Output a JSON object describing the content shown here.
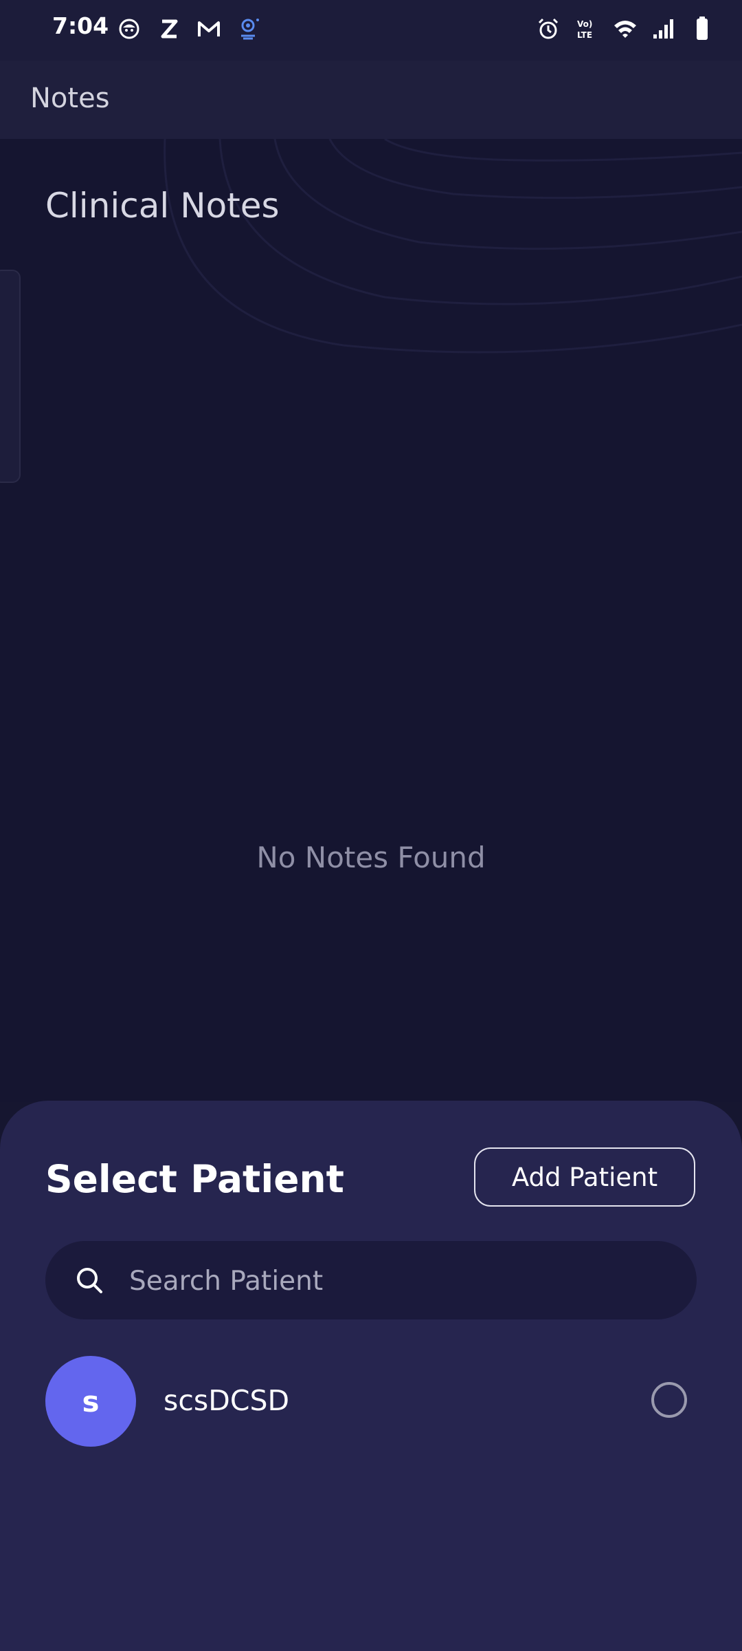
{
  "status_bar": {
    "time": "7:04",
    "left_icons": [
      "app-face-icon",
      "z-icon",
      "gmail-icon",
      "webcam-icon"
    ],
    "right_icons": [
      "alarm-icon",
      "volte-icon",
      "wifi-icon",
      "signal-icon",
      "battery-icon"
    ]
  },
  "app_bar": {
    "title": "Notes"
  },
  "main": {
    "heading": "Clinical Notes",
    "empty_message": "No Notes Found"
  },
  "sheet": {
    "title": "Select Patient",
    "add_button_label": "Add Patient",
    "search": {
      "placeholder": "Search Patient",
      "value": ""
    },
    "patients": [
      {
        "initial": "s",
        "name": "scsDCSD",
        "selected": false
      }
    ]
  },
  "colors": {
    "background": "#151530",
    "sheet": "#26254f",
    "avatar": "#6366ee"
  }
}
